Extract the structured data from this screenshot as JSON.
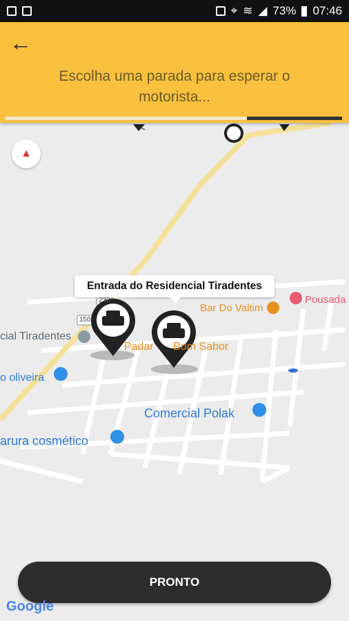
{
  "status_bar": {
    "battery": "73%",
    "time": "07:46"
  },
  "header": {
    "prompt": "Escolha uma parada para esperar o motorista...",
    "progress": 0.7
  },
  "map": {
    "callout": "Entrada do Residencial Tiradentes",
    "places": {
      "bar": "Bar Do Valtim",
      "pousada": "Pousada d",
      "padaria_a": "Padar",
      "padaria_b": "Bom Sabor",
      "tiradentes": "cial Tiradentes",
      "oliveira": "o oliveira",
      "polak": "Comercial Polak",
      "cosmetico": "arura cosmético"
    },
    "road_shields": {
      "a": "150",
      "b": "233"
    }
  },
  "actions": {
    "pronto": "PRONTO"
  },
  "attribution": {
    "google": "Google"
  },
  "colors": {
    "accent": "#f8c03c",
    "button": "#2d2d2d",
    "place_orange": "#e5911f",
    "place_blue": "#2f8ee5"
  }
}
